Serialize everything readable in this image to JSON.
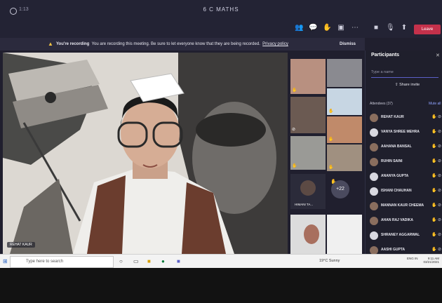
{
  "window": {
    "title": "6 C MATHS",
    "timer": "1:13"
  },
  "banner": {
    "lead": "You're recording",
    "message": "You are recording this meeting. Be sure to let everyone know that they are being recorded.",
    "link": "Privacy policy",
    "dismiss": "Dismiss"
  },
  "toolbar": {
    "leave_label": "Leave"
  },
  "stage": {
    "name_tag": "REHAT KAUR"
  },
  "gallery": {
    "more_count": "+22",
    "tile_name": "HIMANI TA..."
  },
  "participants": {
    "title": "Participants",
    "search_placeholder": "Type a name",
    "share_invite": "Share invite",
    "attendees_label": "Attendees (37)",
    "mute_all": "Mute all",
    "list": [
      {
        "name": "REHAT KAUR"
      },
      {
        "name": "VANYA SHREE MEHRA"
      },
      {
        "name": "AAHANA BANSAL"
      },
      {
        "name": "RUHIN SAINI"
      },
      {
        "name": "ANANYA GUPTA"
      },
      {
        "name": "ISHANI CHAUHAN"
      },
      {
        "name": "MANNAN KAUR CHEEMA"
      },
      {
        "name": "AHAN RAJ VADIKA"
      },
      {
        "name": "SHRANEY AGGARWAL"
      },
      {
        "name": "AASHI GUPTA"
      }
    ]
  },
  "taskbar": {
    "search_placeholder": "Type here to search",
    "weather": "19°C Sunny",
    "language": "ENG IN",
    "time": "9:11 AM",
    "date": "03/21/2021"
  },
  "colors": {
    "accent": "#5b5fc7",
    "leave": "#c4314b",
    "raised_hand": "#f3c343"
  }
}
